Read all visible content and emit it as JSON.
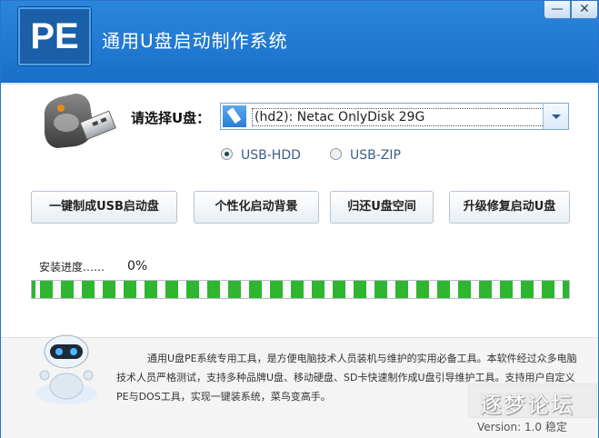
{
  "app": {
    "logo_text": "PE",
    "title": "通用U盘启动制作系统"
  },
  "window_controls": {
    "minimize": "—",
    "close": "✕"
  },
  "icons": {
    "usb": "usb-drive-icon",
    "robot": "robot-mascot-icon",
    "drive": "flash-drive-icon"
  },
  "selector": {
    "label": "请选择U盘：",
    "value": "(hd2): Netac OnlyDisk 29G"
  },
  "radios": [
    {
      "label": "USB-HDD",
      "selected": true
    },
    {
      "label": "USB-ZIP",
      "selected": false
    }
  ],
  "actions": {
    "make": "一键制成USB启动盘",
    "background": "个性化启动背景",
    "restore": "归还U盘空间",
    "upgrade": "升级修复启动U盘"
  },
  "progress": {
    "label": "安装进度……",
    "percent_text": "0%",
    "value": 1.0
  },
  "footer": {
    "description": "通用U盘PE系统专用工具，是方便电脑技术人员装机与维护的实用必备工具。本软件经过众多电脑技术人员严格测试，支持多种品牌U盘、移动硬盘、SD卡快速制作成U盘引导维护工具。支持用户自定义PE与DOS工具，实现一键装系统，菜鸟变高手。",
    "version": "Version: 1.0 稳定",
    "watermark": "逐梦论坛"
  },
  "colors": {
    "title_bar": "#1f78d1",
    "progress": "#2fb52f",
    "radio_text": "#3a5f8a"
  }
}
